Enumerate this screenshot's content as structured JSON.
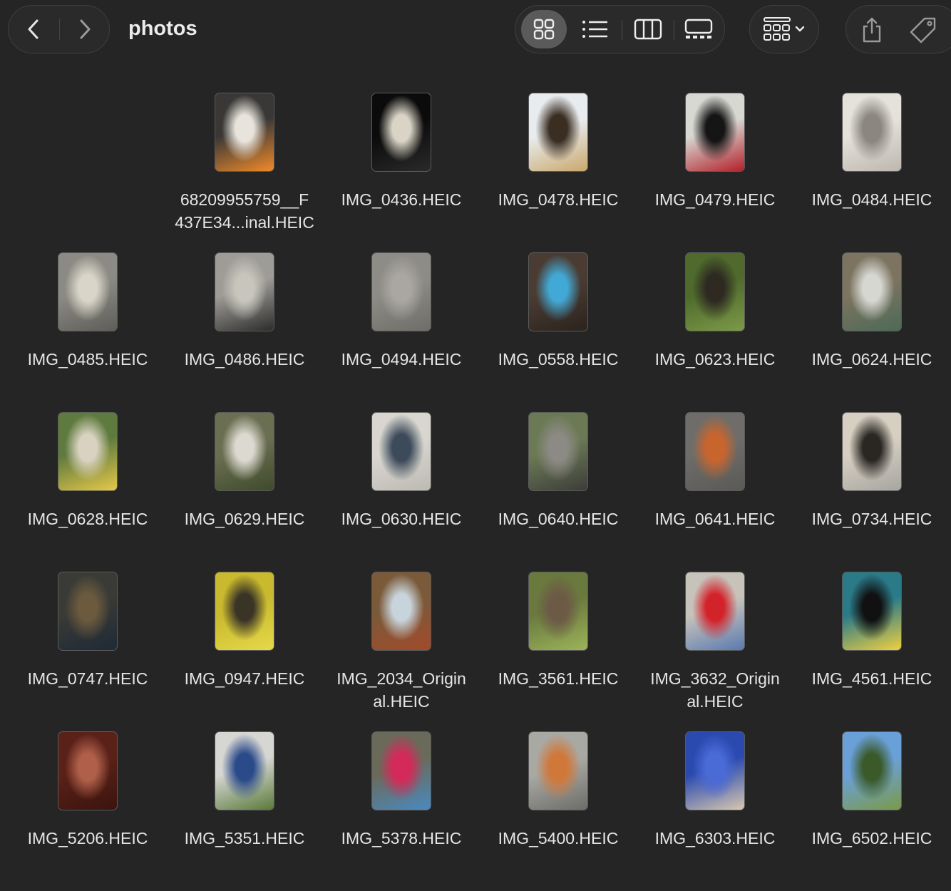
{
  "window": {
    "title": "photos",
    "icons": {
      "back": "chevron-left-icon",
      "forward": "chevron-right-icon",
      "icon_view": "grid-view-icon",
      "list_view": "list-view-icon",
      "column_view": "column-view-icon",
      "gallery_view": "gallery-view-icon",
      "group": "group-by-icon",
      "share": "share-icon",
      "tag": "tag-icon"
    }
  },
  "files": [
    {
      "name_line1": "68209955759__F",
      "name_line2": "437E34...inal.HEIC",
      "colors": [
        "#3a3836",
        "#e8e4dc",
        "#f08a2a"
      ]
    },
    {
      "name_line1": "IMG_0436.HEIC",
      "name_line2": "",
      "colors": [
        "#0b0b0b",
        "#d9d4c5",
        "#2a2a2a"
      ]
    },
    {
      "name_line1": "IMG_0478.HEIC",
      "name_line2": "",
      "colors": [
        "#e9ecef",
        "#3a2e22",
        "#c9a86b"
      ]
    },
    {
      "name_line1": "IMG_0479.HEIC",
      "name_line2": "",
      "colors": [
        "#d8d8d2",
        "#151515",
        "#b3202a"
      ]
    },
    {
      "name_line1": "IMG_0484.HEIC",
      "name_line2": "",
      "colors": [
        "#e5e2dc",
        "#8b8780",
        "#bdb7ae"
      ]
    },
    {
      "name_line1": "IMG_0485.HEIC",
      "name_line2": "",
      "colors": [
        "#8c8a84",
        "#d9d5c8",
        "#5e5d58"
      ]
    },
    {
      "name_line1": "IMG_0486.HEIC",
      "name_line2": "",
      "colors": [
        "#9e9c96",
        "#c8c5bd",
        "#2c2c2c"
      ]
    },
    {
      "name_line1": "IMG_0494.HEIC",
      "name_line2": "",
      "colors": [
        "#8e8c86",
        "#a9a7a0",
        "#6f6d68"
      ]
    },
    {
      "name_line1": "IMG_0558.HEIC",
      "name_line2": "",
      "colors": [
        "#4a3c33",
        "#42a9d6",
        "#2b231e"
      ]
    },
    {
      "name_line1": "IMG_0623.HEIC",
      "name_line2": "",
      "colors": [
        "#4f6a2c",
        "#2e2a22",
        "#7c9a48"
      ]
    },
    {
      "name_line1": "IMG_0624.HEIC",
      "name_line2": "",
      "colors": [
        "#7c7460",
        "#d7d7d2",
        "#4d6a57"
      ]
    },
    {
      "name_line1": "IMG_0628.HEIC",
      "name_line2": "",
      "colors": [
        "#5f7a3e",
        "#d9d2c0",
        "#e6c84a"
      ]
    },
    {
      "name_line1": "IMG_0629.HEIC",
      "name_line2": "",
      "colors": [
        "#6b6f52",
        "#dcd9d0",
        "#3f4a2c"
      ]
    },
    {
      "name_line1": "IMG_0630.HEIC",
      "name_line2": "",
      "colors": [
        "#d8d6cf",
        "#3c4a5a",
        "#bdbab2"
      ]
    },
    {
      "name_line1": "IMG_0640.HEIC",
      "name_line2": "",
      "colors": [
        "#6b7a55",
        "#8c8a84",
        "#3c3c3a"
      ]
    },
    {
      "name_line1": "IMG_0641.HEIC",
      "name_line2": "",
      "colors": [
        "#6e6d6a",
        "#c8652d",
        "#5a5956"
      ]
    },
    {
      "name_line1": "IMG_0734.HEIC",
      "name_line2": "",
      "colors": [
        "#d6cfc2",
        "#2a2622",
        "#a7a6a1"
      ]
    },
    {
      "name_line1": "IMG_0747.HEIC",
      "name_line2": "",
      "colors": [
        "#3a3a36",
        "#6b5a3e",
        "#1e2a36"
      ]
    },
    {
      "name_line1": "IMG_0947.HEIC",
      "name_line2": "",
      "colors": [
        "#c9b92e",
        "#3a3427",
        "#e5d94a"
      ]
    },
    {
      "name_line1": "IMG_2034_Origin",
      "name_line2": "al.HEIC",
      "colors": [
        "#7b5a3a",
        "#c8d4dc",
        "#a24a2a"
      ]
    },
    {
      "name_line1": "IMG_3561.HEIC",
      "name_line2": "",
      "colors": [
        "#6a7a3e",
        "#6c5a46",
        "#9cb45a"
      ]
    },
    {
      "name_line1": "IMG_3632_Origin",
      "name_line2": "al.HEIC",
      "colors": [
        "#c7c3bb",
        "#d3232a",
        "#5a7ab0"
      ]
    },
    {
      "name_line1": "IMG_4561.HEIC",
      "name_line2": "",
      "colors": [
        "#2a7a88",
        "#111111",
        "#f0d040"
      ]
    },
    {
      "name_line1": "IMG_5206.HEIC",
      "name_line2": "",
      "colors": [
        "#5a2118",
        "#b0604a",
        "#3a140e"
      ]
    },
    {
      "name_line1": "IMG_5351.HEIC",
      "name_line2": "",
      "colors": [
        "#d6d6d2",
        "#2a4a8a",
        "#5a7a3a"
      ]
    },
    {
      "name_line1": "IMG_5378.HEIC",
      "name_line2": "",
      "colors": [
        "#6a6a5a",
        "#d32a5a",
        "#4a8ac0"
      ]
    },
    {
      "name_line1": "IMG_5400.HEIC",
      "name_line2": "",
      "colors": [
        "#a9a9a4",
        "#d0783a",
        "#6c6c68"
      ]
    },
    {
      "name_line1": "IMG_6303.HEIC",
      "name_line2": "",
      "colors": [
        "#2a4ab0",
        "#4a6ad6",
        "#d8c8b0"
      ]
    },
    {
      "name_line1": "IMG_6502.HEIC",
      "name_line2": "",
      "colors": [
        "#6aa0d8",
        "#3a5a2a",
        "#7a9a4a"
      ]
    }
  ]
}
